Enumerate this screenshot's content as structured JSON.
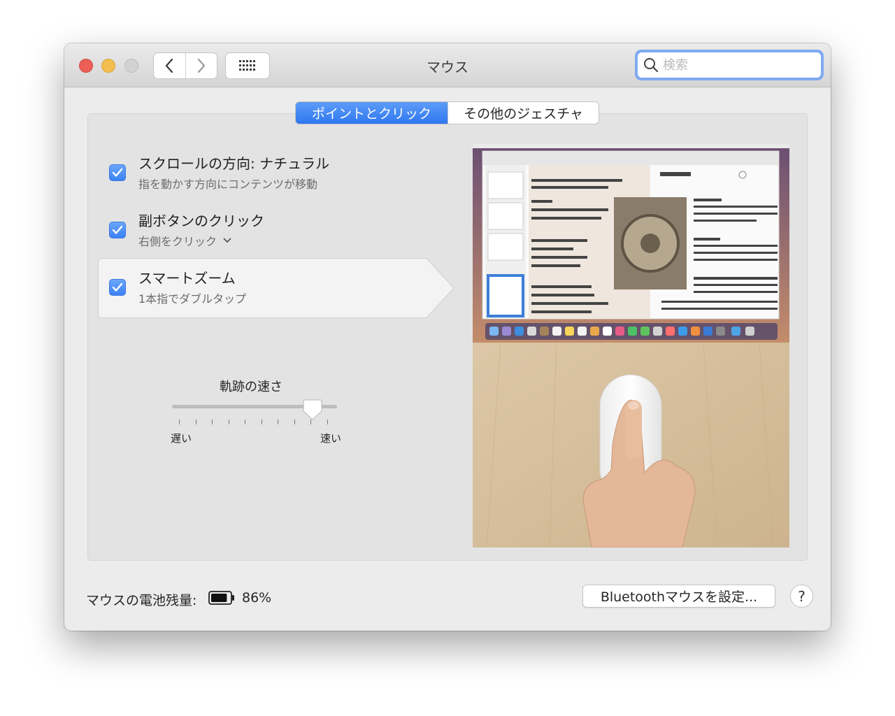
{
  "window": {
    "title": "マウス",
    "search": {
      "placeholder": "検索",
      "value": ""
    }
  },
  "tabs": [
    {
      "label": "ポイントとクリック",
      "active": true
    },
    {
      "label": "その他のジェスチャ",
      "active": false
    }
  ],
  "options": [
    {
      "title": "スクロールの方向: ナチュラル",
      "subtitle": "指を動かす方向にコンテンツが移動",
      "checked": true
    },
    {
      "title": "副ボタンのクリック",
      "subtitle": "右側をクリック",
      "checked": true,
      "has_dropdown": true
    },
    {
      "title": "スマートズーム",
      "subtitle": "1本指でダブルタップ",
      "checked": true,
      "selected": true
    }
  ],
  "tracking_speed": {
    "label": "軌跡の速さ",
    "min_label": "遅い",
    "max_label": "速い",
    "value": 0.85,
    "tick_count": 10
  },
  "battery": {
    "label": "マウスの電池残量:",
    "percent": "86%",
    "level": 0.86
  },
  "buttons": {
    "bluetooth": "Bluetoothマウスを設定...",
    "help": "?"
  },
  "colors": {
    "accent": "#3b82f5",
    "close": "#ec5f56",
    "minimize": "#f3be4f",
    "zoom_disabled": "#d2d2d2"
  },
  "icons": [
    "close-icon",
    "minimize-icon",
    "zoom-icon",
    "chevron-left-icon",
    "chevron-right-icon",
    "grid-icon",
    "search-icon",
    "checkmark-icon",
    "chevron-down-icon",
    "battery-icon"
  ]
}
